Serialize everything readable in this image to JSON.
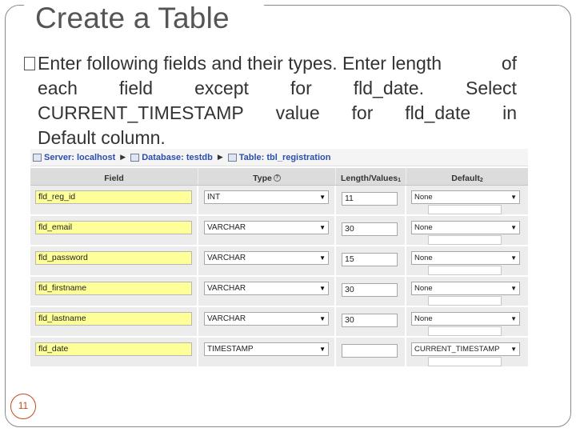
{
  "slide": {
    "title": "Create a Table",
    "bullet": {
      "line1_words": [
        "Enter following fields and their types. Enter length",
        "of"
      ],
      "line2_words": [
        "each",
        "field",
        "except",
        "for",
        "fld_date.",
        "Select"
      ],
      "line3_words": [
        "CURRENT_TIMESTAMP",
        "value",
        "for",
        "fld_date",
        "in"
      ],
      "line4": "Default column."
    },
    "slide_number": "11"
  },
  "breadcrumb": {
    "server": "Server: localhost",
    "database": "Database: testdb",
    "table": "Table: tbl_registration"
  },
  "table": {
    "headers": {
      "field": "Field",
      "type": "Type",
      "type_help": "?",
      "length": "Length/Values",
      "length_sup": "1",
      "default": "Default",
      "default_sup": "2"
    },
    "rows": [
      {
        "field": "fld_reg_id",
        "type": "INT",
        "length": "11",
        "default": "None"
      },
      {
        "field": "fld_email",
        "type": "VARCHAR",
        "length": "30",
        "default": "None"
      },
      {
        "field": "fld_password",
        "type": "VARCHAR",
        "length": "15",
        "default": "None"
      },
      {
        "field": "fld_firstname",
        "type": "VARCHAR",
        "length": "30",
        "default": "None"
      },
      {
        "field": "fld_lastname",
        "type": "VARCHAR",
        "length": "30",
        "default": "None"
      },
      {
        "field": "fld_date",
        "type": "TIMESTAMP",
        "length": "",
        "default": "CURRENT_TIMESTAMP"
      }
    ]
  },
  "colors": {
    "field_input_bg": "#ffff99",
    "slide_number_accent": "#c8471e",
    "link_blue": "#2b4fa8"
  },
  "icons": {
    "bullet": "square-bullet-icon",
    "breadcrumb_server": "server-icon",
    "breadcrumb_database": "database-icon",
    "breadcrumb_table": "table-icon",
    "dropdown": "dropdown-arrow-icon"
  }
}
